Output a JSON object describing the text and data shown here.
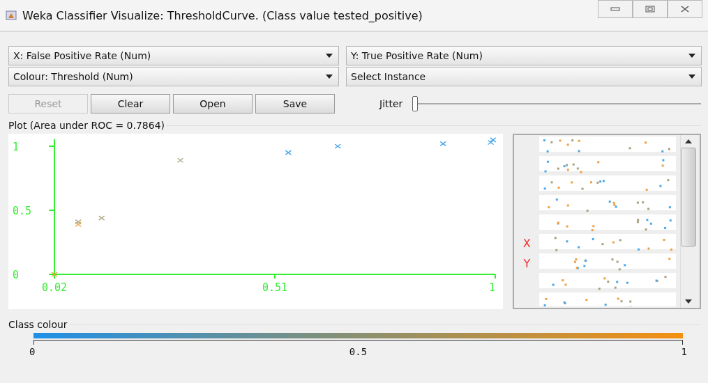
{
  "window": {
    "title": "Weka Classifier Visualize: ThresholdCurve. (Class value tested_positive)"
  },
  "selectors": [
    {
      "label": "X: False Positive Rate (Num)"
    },
    {
      "label": "Y: True Positive Rate (Num)"
    },
    {
      "label": "Colour: Threshold (Num)"
    },
    {
      "label": "Select Instance"
    }
  ],
  "buttons": [
    {
      "label": "Reset",
      "disabled": true
    },
    {
      "label": "Clear",
      "disabled": false
    },
    {
      "label": "Open",
      "disabled": false
    },
    {
      "label": "Save",
      "disabled": false
    }
  ],
  "jitter": {
    "label": "Jitter",
    "level": 0
  },
  "plot": {
    "title": "Plot (Area under ROC = 0.7864)",
    "chart_data": {
      "type": "scatter",
      "x": [
        0.02,
        0.073,
        0.073,
        0.125,
        0.3,
        0.54,
        0.65,
        0.884,
        0.99,
        0.995
      ],
      "xlim": [
        0.02,
        1
      ],
      "ylim": [
        0,
        1.05
      ],
      "xticks": [
        0.02,
        0.51,
        1
      ],
      "yticks": [
        0,
        0.5,
        1
      ],
      "series": [
        {
          "color": "#f0a040",
          "values": [
            0,
            null,
            0.39,
            null,
            null,
            null,
            null,
            null,
            null,
            null
          ]
        },
        {
          "color": "#b0aa88",
          "values": [
            null,
            0.41,
            null,
            0.44,
            0.89,
            null,
            null,
            null,
            null,
            null
          ]
        },
        {
          "color": "#4aa8e8",
          "values": [
            null,
            null,
            null,
            null,
            null,
            0.95,
            1.0,
            1.02,
            1.03,
            1.05
          ]
        }
      ]
    }
  },
  "matrix": {
    "labels": [
      "X",
      "Y"
    ]
  },
  "class_colour": {
    "title": "Class colour",
    "ticks": [
      "0",
      "0.5",
      "1"
    ]
  }
}
